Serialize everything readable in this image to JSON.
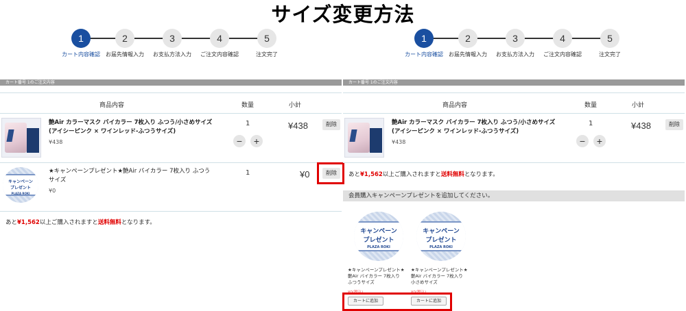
{
  "title": "サイズ変更方法",
  "steps": [
    {
      "num": "1",
      "label": "カート内容確認"
    },
    {
      "num": "2",
      "label": "お届先情報入力"
    },
    {
      "num": "3",
      "label": "お支払方法入力"
    },
    {
      "num": "4",
      "label": "ご注文内容確認"
    },
    {
      "num": "5",
      "label": "注文完了"
    }
  ],
  "cart_header": "カート番号 1のご注文内容",
  "columns": {
    "product": "商品内容",
    "qty": "数量",
    "subtotal": "小計"
  },
  "product": {
    "name_line1": "艶Air カラーマスク バイカラー 7枚入り ふつう/小さめサイズ",
    "name_line2": "(アイシーピンク × ワインレッド-ふつうサイズ)",
    "price": "¥438",
    "qty": "1",
    "subtotal": "¥438",
    "minus": "−",
    "plus": "+",
    "delete": "削除"
  },
  "gift_item": {
    "name_line1": "★キャンペーンプレゼント★艶Air バイカラー 7枚入り ふつう",
    "name_line2": "サイズ",
    "price": "¥0",
    "qty": "1",
    "subtotal": "¥0",
    "delete": "削除"
  },
  "badge": {
    "line1": "キャンペーン",
    "line2": "プレゼント",
    "line3": "PLAZA ROKI"
  },
  "shipping": {
    "prefix": "あと",
    "amount": "¥1,562",
    "middle": "以上ご購入されますと",
    "free": "送料無料",
    "suffix": "となります。"
  },
  "campaign_bar": "会員購入キャンペーンプレゼントを追加してください。",
  "gifts": [
    {
      "name": "★キャンペーンプレゼント★艶Air バイカラー 7枚入り ふつうサイズ",
      "price": "¥0(税込)",
      "button": "カートに追加"
    },
    {
      "name": "★キャンペーンプレゼント★艶Air バイカラー 7枚入り 小さめサイズ",
      "price": "¥0(税込)",
      "button": "カートに追加"
    }
  ],
  "colors": {
    "accent": "#1a4fa0",
    "highlight": "#e00000",
    "header_bar": "#9a9a9a"
  }
}
